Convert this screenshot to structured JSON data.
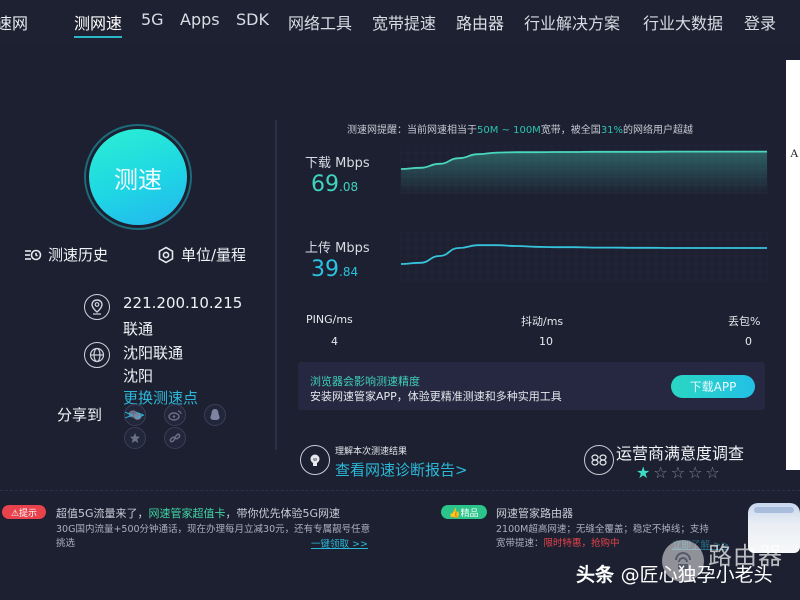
{
  "header": {
    "brand": "速网",
    "nav": [
      {
        "label": "测网速",
        "active": true
      },
      {
        "label": "5G"
      },
      {
        "label": "Apps"
      },
      {
        "label": "SDK"
      },
      {
        "label": "网络工具"
      },
      {
        "label": "宽带提速"
      },
      {
        "label": "路由器"
      },
      {
        "label": "行业解决方案"
      },
      {
        "label": "行业大数据"
      },
      {
        "label": "登录"
      }
    ]
  },
  "left": {
    "test_button": "测速",
    "history_label": "测速历史",
    "unit_label": "单位/量程",
    "ip": "221.200.10.215",
    "isp": "联通",
    "server_name": "沈阳联通",
    "server_city": "沈阳",
    "change_server": "更换测速点",
    "share_label": "分享到",
    "share_more": ">>",
    "share_icons": [
      "wechat-icon",
      "weibo-icon",
      "qq-icon",
      "favorite-icon",
      "link-icon"
    ]
  },
  "right": {
    "notice_prefix": "测速网提醒：当前网速相当于",
    "notice_range": "50M ~ 100M",
    "notice_mid": "宽带，被全国",
    "notice_pct": "31%",
    "notice_suffix": "的网络用户超越",
    "download": {
      "label": "下载 Mbps",
      "int": "69",
      "dec": ".08"
    },
    "upload": {
      "label": "上传 Mbps",
      "int": "39",
      "dec": ".84"
    },
    "stats": [
      {
        "label": "PING/ms",
        "value": "4"
      },
      {
        "label": "抖动/ms",
        "value": "10"
      },
      {
        "label": "丢包%",
        "value": "0"
      }
    ],
    "promo": {
      "title": "浏览器会影响测速精度",
      "subtitle": "安装网速管家APP，体验更精准测速和多种实用工具",
      "button": "下载APP"
    },
    "report": {
      "small": "理解本次测速结果",
      "link": "查看网速诊断报告>"
    },
    "survey": {
      "title": "运营商满意度调查",
      "rating": 1,
      "max": 5
    }
  },
  "chart_data": [
    {
      "type": "line",
      "title": "下载 Mbps",
      "series": [
        {
          "name": "download",
          "values": [
            0.55,
            0.58,
            0.68,
            0.82,
            0.92,
            0.96,
            0.97,
            0.97,
            0.975,
            0.975,
            0.98,
            0.98,
            0.98,
            0.98,
            0.985,
            0.985,
            0.985,
            0.985,
            0.985,
            0.985
          ]
        }
      ],
      "color": "#4ad6bd",
      "fill": true,
      "grid": true
    },
    {
      "type": "line",
      "title": "上传 Mbps",
      "series": [
        {
          "name": "upload",
          "values": [
            0.35,
            0.38,
            0.55,
            0.75,
            0.82,
            0.82,
            0.8,
            0.78,
            0.77,
            0.77,
            0.76,
            0.76,
            0.755,
            0.755,
            0.75,
            0.75,
            0.75,
            0.75,
            0.75,
            0.75
          ]
        }
      ],
      "color": "#36c4dc",
      "fill": false,
      "grid": true
    }
  ],
  "ads": {
    "left": {
      "tag": "⚠提示",
      "title_prefix": "超值5G流量来了，",
      "title_green": "网速管家超值卡",
      "title_suffix": "，带你优先体验5G网速",
      "body": "30G国内流量+500分钟通话，现在办理每月立减30元，还有专属靓号任意挑选",
      "link": "一键领取 >>"
    },
    "right": {
      "tag": "👍精品",
      "title": "网速管家路由器",
      "body_1": "2100M超高网速；无缝全覆盖；稳定不掉线；支持",
      "body_2_prefix": "宽带提速：",
      "body_2_red": "限时特惠，抢购中",
      "link": "立即了解 >>"
    }
  },
  "watermark": {
    "brand": "路由器",
    "author_prefix": "头条",
    "author": "@匠心独孕小老头"
  },
  "side_panel": {
    "text": "A"
  },
  "colors": {
    "background": "#1d2030",
    "accent_teal": "#2bc4b0",
    "accent_blue": "#2bb8d8",
    "warn_red": "#e8434c",
    "good_green": "#2bc48a"
  }
}
